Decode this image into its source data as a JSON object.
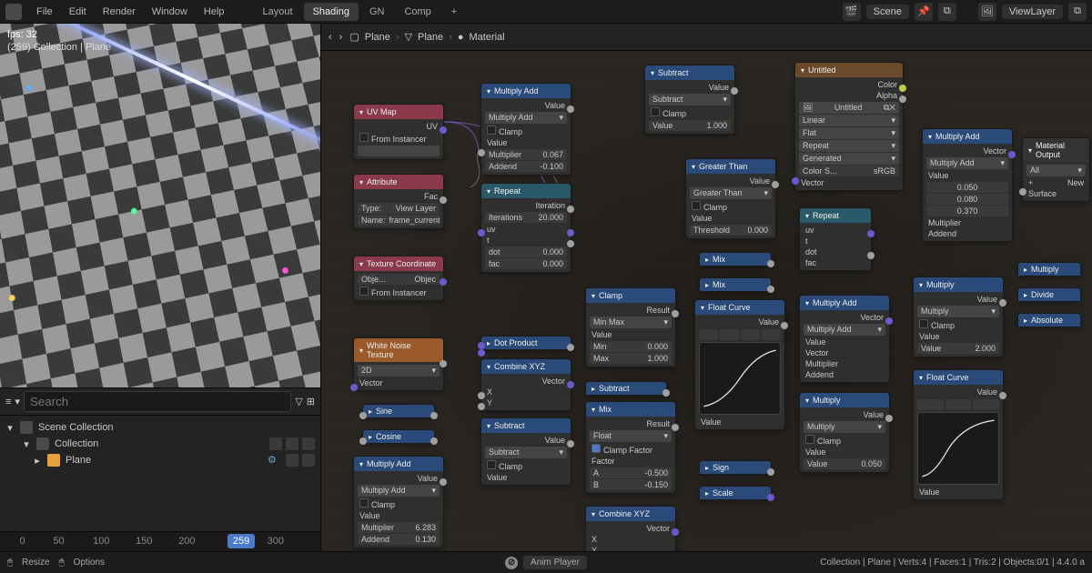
{
  "topbar": {
    "menus": [
      "File",
      "Edit",
      "Render",
      "Window",
      "Help"
    ],
    "workspaces": [
      {
        "label": "Layout",
        "active": false
      },
      {
        "label": "Shading",
        "active": true
      },
      {
        "label": "GN",
        "active": false
      },
      {
        "label": "Comp",
        "active": false
      }
    ],
    "scene_label": "Scene",
    "viewlayer_label": "ViewLayer"
  },
  "viewport": {
    "fps": "fps: 32",
    "context": "(259) Collection | Plane"
  },
  "outliner": {
    "search_placeholder": "Search",
    "rows": [
      {
        "kind": "collection",
        "label": "Scene Collection",
        "depth": 0,
        "expand": "▾",
        "toggles": 0
      },
      {
        "kind": "collection",
        "label": "Collection",
        "depth": 1,
        "expand": "▾",
        "toggles": 3
      },
      {
        "kind": "object",
        "label": "Plane",
        "depth": 2,
        "expand": "▸",
        "toggles": 2
      }
    ]
  },
  "timeline": {
    "ticks": [
      {
        "v": "0",
        "p": 4
      },
      {
        "v": "50",
        "p": 15
      },
      {
        "v": "100",
        "p": 28
      },
      {
        "v": "150",
        "p": 42
      },
      {
        "v": "200",
        "p": 56
      },
      {
        "v": "300",
        "p": 85
      }
    ],
    "playhead": {
      "v": "259",
      "p": 72
    }
  },
  "node_header": {
    "crumbs": [
      "Plane",
      "Plane",
      "Material"
    ]
  },
  "nodes": {
    "uvmap": {
      "title": "UV Map",
      "from_instancer": "From Instancer",
      "out": "UV"
    },
    "attribute": {
      "title": "Attribute",
      "out": "Fac",
      "type_lbl": "Type:",
      "type_val": "View Layer",
      "name_lbl": "Name:",
      "name_val": "frame_current"
    },
    "texcoord": {
      "title": "Texture Coordinate",
      "obj_lbl": "Obje...",
      "obj_val": "Objec",
      "from_instancer": "From Instancer"
    },
    "whitenoise": {
      "title": "White Noise Texture",
      "dim": "2D",
      "vec": "Vector"
    },
    "sine": {
      "title": "Sine"
    },
    "cosine": {
      "title": "Cosine"
    },
    "muladd1": {
      "title": "Multiply Add",
      "out": "Value",
      "mode": "Multiply Add",
      "clamp": "Clamp",
      "value_lbl": "Value",
      "mult_lbl": "Multiplier",
      "mult_val": "0.067",
      "add_lbl": "Addend",
      "add_val": "-0.100"
    },
    "muladd2": {
      "title": "Multiply Add",
      "out": "Value",
      "mode": "Multiply Add",
      "clamp": "Clamp",
      "value_lbl": "Value",
      "mult_lbl": "Multiplier",
      "mult_val": "6.283",
      "add_lbl": "Addend",
      "add_val": "0.130"
    },
    "repeat": {
      "title": "Repeat",
      "iter_lbl": "Iteration",
      "iters_lbl": "Iterations",
      "iters_val": "20.000",
      "uv": "uv",
      "t": "t",
      "dot_lbl": "dot",
      "dot_val": "0.000",
      "fac_lbl": "fac",
      "fac_val": "0.000"
    },
    "dotprod": {
      "title": "Dot Product"
    },
    "combinexyz1": {
      "title": "Combine XYZ",
      "out": "Vector",
      "x": "X",
      "y": "Y"
    },
    "combinexyz2": {
      "title": "Combine XYZ",
      "out": "Vector",
      "x": "X",
      "y": "Y"
    },
    "subtract_vec": {
      "title": "Subtract",
      "mode": "Subtract",
      "clamp": "Clamp",
      "out": "Value"
    },
    "clamp": {
      "title": "Clamp",
      "out": "Result",
      "mode": "Min Max",
      "value": "Value",
      "min_lbl": "Min",
      "min_val": "0.000",
      "max_lbl": "Max",
      "max_val": "1.000"
    },
    "subtract2": {
      "title": "Subtract"
    },
    "mix": {
      "title": "Mix",
      "out": "Result",
      "mode": "Float",
      "clampf": "Clamp Factor",
      "factor": "Factor",
      "a_lbl": "A",
      "a_val": "-0.500",
      "b_lbl": "B",
      "b_val": "-0.150"
    },
    "subtract_top": {
      "title": "Subtract",
      "out": "Value",
      "mode": "Subtract",
      "clamp": "Clamp",
      "value_lbl": "Value",
      "value_val": "1.000"
    },
    "greater": {
      "title": "Greater Than",
      "out": "Value",
      "mode": "Greater Than",
      "clamp": "Clamp",
      "value": "Value",
      "thr_lbl": "Threshold",
      "thr_val": "0.000"
    },
    "mix_c1": {
      "title": "Mix"
    },
    "mix_c2": {
      "title": "Mix"
    },
    "floatcurve1": {
      "title": "Float Curve",
      "out": "Value",
      "value": "Value"
    },
    "sign": {
      "title": "Sign"
    },
    "scale": {
      "title": "Scale"
    },
    "untitled": {
      "title": "Untitled",
      "out_color": "Color",
      "out_alpha": "Alpha",
      "img_name": "Untitled",
      "interp": "Linear",
      "proj": "Flat",
      "ext": "Repeat",
      "source": "Generated",
      "cs_lbl": "Color S...",
      "cs_val": "sRGB",
      "vec": "Vector"
    },
    "repeat_out": {
      "title": "Repeat",
      "uv": "uv",
      "t": "t",
      "dot": "dot",
      "fac": "fac"
    },
    "muladd3": {
      "title": "Multiply Add",
      "out": "Vector",
      "mode": "Multiply Add",
      "value": "Value",
      "vector": "Vector",
      "mult": "Multiplier",
      "add": "Addend"
    },
    "multiply_math": {
      "title": "Multiply",
      "out": "Value",
      "mode": "Multiply",
      "clamp": "Clamp",
      "value": "Value",
      "val2_lbl": "Value",
      "val2_val": "0.050"
    },
    "muladd_top": {
      "title": "Multiply Add",
      "out": "Vector",
      "mode": "Multiply Add",
      "v1": "0.050",
      "v2": "0.080",
      "v3": "0.370",
      "value": "Value",
      "mult": "Multiplier",
      "add": "Addend"
    },
    "multiply2": {
      "title": "Multiply",
      "out": "Value",
      "mode": "Multiply",
      "clamp": "Clamp",
      "value": "Value",
      "val2_lbl": "Value",
      "val2_val": "2.000"
    },
    "floatcurve2": {
      "title": "Float Curve",
      "out": "Value",
      "value": "Value"
    },
    "multiply_c": {
      "title": "Multiply"
    },
    "divide_c": {
      "title": "Divide"
    },
    "absolute_c": {
      "title": "Absolute"
    },
    "matoutput": {
      "title": "Material Output",
      "all": "All",
      "surface": "Surface",
      "new": "New"
    }
  },
  "status": {
    "left": [
      {
        "lbl": "Resize"
      },
      {
        "lbl": "Options"
      }
    ],
    "center": "Anim Player",
    "right": "Collection | Plane | Verts:4 | Faces:1 | Tris:2 | Objects:0/1 | 4.4.0 a"
  }
}
